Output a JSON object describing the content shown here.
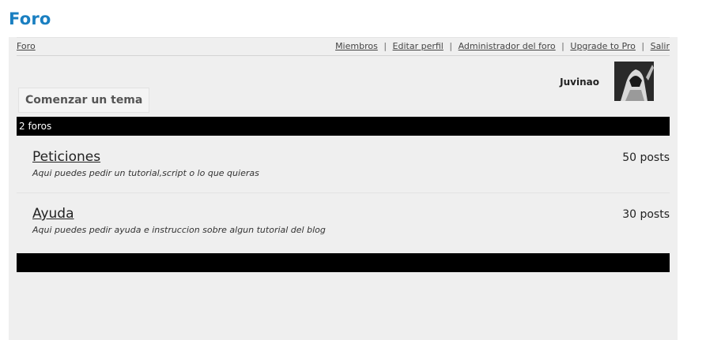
{
  "page": {
    "title": "Foro"
  },
  "nav": {
    "home_label": "Foro",
    "links": [
      {
        "label": "Miembros"
      },
      {
        "label": "Editar perfil"
      },
      {
        "label": "Administrador del foro"
      },
      {
        "label": "Upgrade to Pro"
      },
      {
        "label": "Salir"
      }
    ],
    "separator": "|"
  },
  "user": {
    "name": "Juvinao",
    "avatar_icon": "avatar-image"
  },
  "actions": {
    "new_topic_label": "Comenzar un tema"
  },
  "forums_header": {
    "count_label": "2 foros"
  },
  "forums": [
    {
      "name": "Peticiones",
      "description": "Aqui puedes pedir un tutorial,script o lo que quieras",
      "posts": "50 posts"
    },
    {
      "name": "Ayuda",
      "description": "Aqui puedes pedir ayuda e instruccion sobre algun tutorial del blog",
      "posts": "30 posts"
    }
  ],
  "colors": {
    "title": "#1a7fc1",
    "bar": "#000000",
    "panel": "#efefef"
  }
}
